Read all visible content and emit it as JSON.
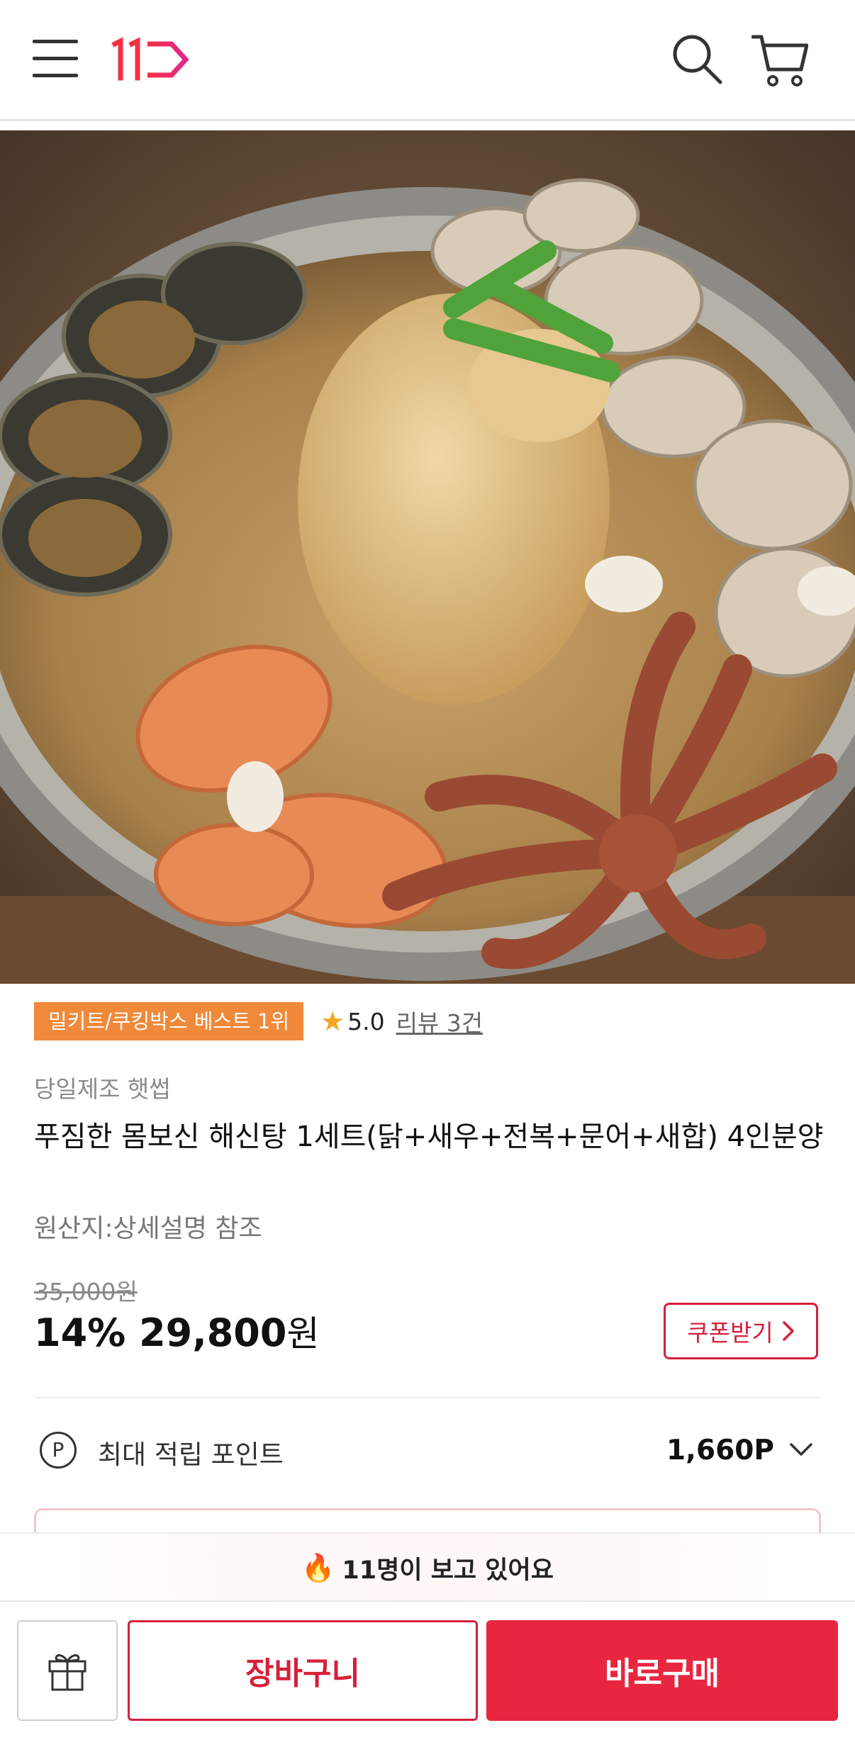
{
  "header": {
    "logo_text": "11",
    "menu_icon": "hamburger-menu-icon",
    "search_icon": "search-icon",
    "cart_icon": "cart-icon"
  },
  "product_image": {
    "subject": "seafood-chicken-stew-photo"
  },
  "badge": {
    "text": "밀키트/쿠킹박스 베스트 1위",
    "color": "#f0893a"
  },
  "rating": {
    "score": "5.0",
    "review_link": "리뷰 3건"
  },
  "product": {
    "brand": "당일제조 햇썹",
    "title": "푸짐한 몸보신 해신탕 1세트(닭+새우+전복+문어+새합) 4인분양",
    "origin": "원산지:상세설명 참조"
  },
  "price": {
    "original": "35,000원",
    "discount": "14%",
    "sale": "29,800",
    "currency": "원",
    "coupon_button": "쿠폰받기"
  },
  "points": {
    "icon_letter": "P",
    "label": "최대 적립 포인트",
    "value": "1,660P"
  },
  "viewers": {
    "text": "11명이 보고 있어요"
  },
  "bottom_bar": {
    "cart_button": "장바구니",
    "buy_button": "바로구매"
  },
  "colors": {
    "accent": "#e8263f",
    "accent_border": "#d61f3a",
    "badge": "#f0893a",
    "star": "#f5a623"
  }
}
